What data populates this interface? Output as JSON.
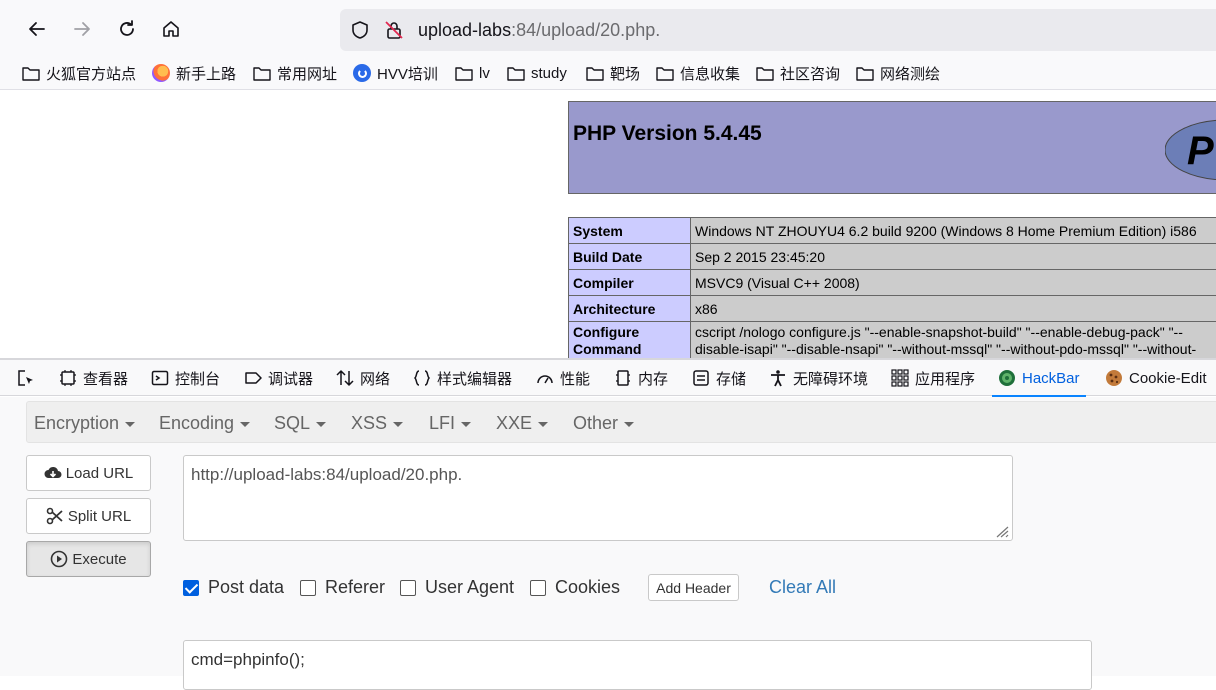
{
  "browser": {
    "url_host": "upload-labs",
    "url_path": ":84/upload/20.php.",
    "bookmarks": [
      {
        "label": "火狐官方站点",
        "icon": "folder-icon"
      },
      {
        "label": "新手上路",
        "icon": "firefox-icon"
      },
      {
        "label": "常用网址",
        "icon": "folder-icon"
      },
      {
        "label": "HVV培训",
        "icon": "hvv-icon"
      },
      {
        "label": "lv",
        "icon": "folder-icon"
      },
      {
        "label": "study",
        "icon": "folder-icon"
      },
      {
        "label": "靶场",
        "icon": "folder-icon"
      },
      {
        "label": "信息收集",
        "icon": "folder-icon"
      },
      {
        "label": "社区咨询",
        "icon": "folder-icon"
      },
      {
        "label": "网络测绘",
        "icon": "folder-icon"
      }
    ]
  },
  "phpinfo": {
    "title": "PHP Version 5.4.45",
    "rows": [
      {
        "key": "System",
        "value": "Windows NT ZHOUYU4 6.2 build 9200 (Windows 8 Home Premium Edition) i586"
      },
      {
        "key": "Build Date",
        "value": "Sep 2 2015 23:45:20"
      },
      {
        "key": "Compiler",
        "value": "MSVC9 (Visual C++ 2008)"
      },
      {
        "key": "Architecture",
        "value": "x86"
      },
      {
        "key": "Configure Command",
        "value": "cscript /nologo configure.js \"--enable-snapshot-build\" \"--enable-debug-pack\" \"--disable-isapi\" \"--disable-nsapi\" \"--without-mssql\" \"--without-pdo-mssql\" \"--without-"
      }
    ]
  },
  "devtools": {
    "tabs": [
      {
        "label": "查看器",
        "icon": "inspector-icon"
      },
      {
        "label": "控制台",
        "icon": "console-icon"
      },
      {
        "label": "调试器",
        "icon": "debugger-icon"
      },
      {
        "label": "网络",
        "icon": "network-icon"
      },
      {
        "label": "样式编辑器",
        "icon": "style-editor-icon"
      },
      {
        "label": "性能",
        "icon": "performance-icon"
      },
      {
        "label": "内存",
        "icon": "memory-icon"
      },
      {
        "label": "存储",
        "icon": "storage-icon"
      },
      {
        "label": "无障碍环境",
        "icon": "accessibility-icon"
      },
      {
        "label": "应用程序",
        "icon": "application-icon"
      },
      {
        "label": "HackBar",
        "icon": "hackbar-icon",
        "active": true
      },
      {
        "label": "Cookie-Edit",
        "icon": "cookie-icon"
      }
    ]
  },
  "hackbar": {
    "menu": [
      "Encryption",
      "Encoding",
      "SQL",
      "XSS",
      "LFI",
      "XXE",
      "Other"
    ],
    "load_url": "Load URL",
    "split_url": "Split URL",
    "execute": "Execute",
    "url_value": "http://upload-labs:84/upload/20.php.",
    "options": [
      {
        "label": "Post data",
        "checked": true
      },
      {
        "label": "Referer",
        "checked": false
      },
      {
        "label": "User Agent",
        "checked": false
      },
      {
        "label": "Cookies",
        "checked": false
      }
    ],
    "add_header": "Add Header",
    "clear_all": "Clear All",
    "post_value": "cmd=phpinfo();"
  },
  "colors": {
    "php_header": "#9999cc",
    "php_key": "#ccccff",
    "php_value": "#cccccc",
    "accent": "#0060df",
    "link": "#337ab7"
  }
}
